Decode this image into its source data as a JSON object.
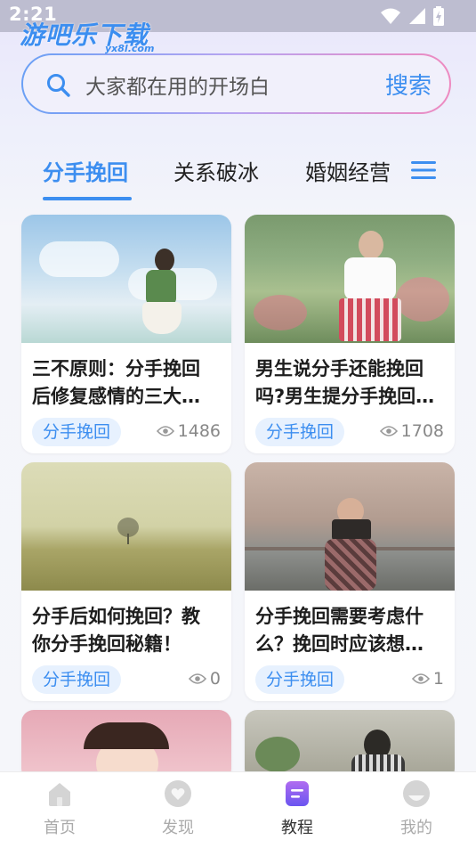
{
  "status_bar": {
    "time": "2:21"
  },
  "watermark": {
    "text": "游吧乐下载",
    "sub": "yx8l.com"
  },
  "search": {
    "placeholder": "大家都在用的开场白",
    "button_label": "搜索"
  },
  "tabs": [
    {
      "label": "分手挽回",
      "active": true
    },
    {
      "label": "关系破冰",
      "active": false
    },
    {
      "label": "婚姻经营",
      "active": false
    }
  ],
  "articles": [
    {
      "title_line1": "三不原则：分手挽回",
      "title_line2": "后修复感情的三大…",
      "tag": "分手挽回",
      "views": "1486"
    },
    {
      "title_line1": "男生说分手还能挽回",
      "title_line2": "吗?男生提分手挽回…",
      "tag": "分手挽回",
      "views": "1708"
    },
    {
      "title_line1": "分手后如何挽回？教",
      "title_line2": "你分手挽回秘籍！",
      "tag": "分手挽回",
      "views": "0"
    },
    {
      "title_line1": "分手挽回需要考虑什",
      "title_line2": "么？挽回时应该想…",
      "tag": "分手挽回",
      "views": "1"
    }
  ],
  "bottom_nav": [
    {
      "label": "首页",
      "icon": "home-icon",
      "active": false
    },
    {
      "label": "发现",
      "icon": "discover-icon",
      "active": false
    },
    {
      "label": "教程",
      "icon": "tutorial-icon",
      "active": true
    },
    {
      "label": "我的",
      "icon": "profile-icon",
      "active": false
    }
  ],
  "colors": {
    "accent": "#3c8ef0",
    "tag_bg": "#e7f1fe",
    "tutorial_purple": "#8a5cf0"
  }
}
